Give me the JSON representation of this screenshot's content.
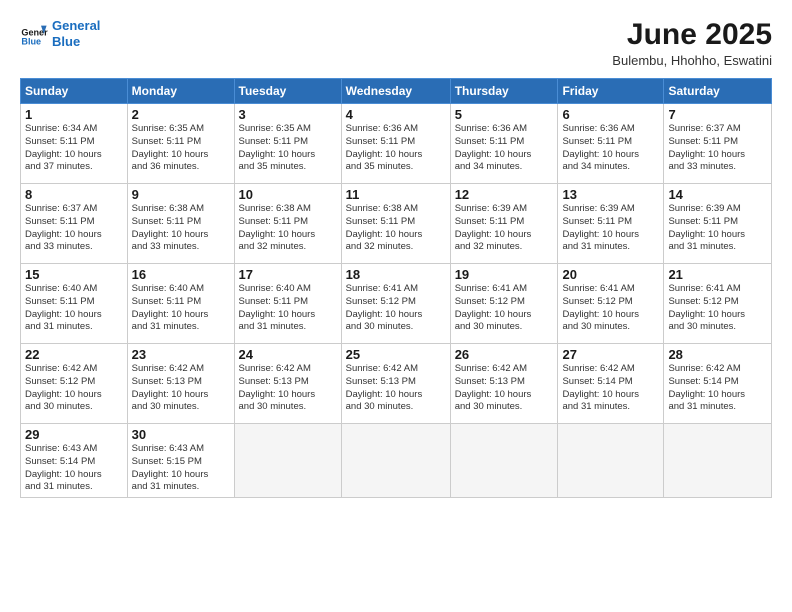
{
  "header": {
    "logo_line1": "General",
    "logo_line2": "Blue",
    "month": "June 2025",
    "location": "Bulembu, Hhohho, Eswatini"
  },
  "weekdays": [
    "Sunday",
    "Monday",
    "Tuesday",
    "Wednesday",
    "Thursday",
    "Friday",
    "Saturday"
  ],
  "weeks": [
    [
      {
        "day": "1",
        "info": "Sunrise: 6:34 AM\nSunset: 5:11 PM\nDaylight: 10 hours\nand 37 minutes."
      },
      {
        "day": "2",
        "info": "Sunrise: 6:35 AM\nSunset: 5:11 PM\nDaylight: 10 hours\nand 36 minutes."
      },
      {
        "day": "3",
        "info": "Sunrise: 6:35 AM\nSunset: 5:11 PM\nDaylight: 10 hours\nand 35 minutes."
      },
      {
        "day": "4",
        "info": "Sunrise: 6:36 AM\nSunset: 5:11 PM\nDaylight: 10 hours\nand 35 minutes."
      },
      {
        "day": "5",
        "info": "Sunrise: 6:36 AM\nSunset: 5:11 PM\nDaylight: 10 hours\nand 34 minutes."
      },
      {
        "day": "6",
        "info": "Sunrise: 6:36 AM\nSunset: 5:11 PM\nDaylight: 10 hours\nand 34 minutes."
      },
      {
        "day": "7",
        "info": "Sunrise: 6:37 AM\nSunset: 5:11 PM\nDaylight: 10 hours\nand 33 minutes."
      }
    ],
    [
      {
        "day": "8",
        "info": "Sunrise: 6:37 AM\nSunset: 5:11 PM\nDaylight: 10 hours\nand 33 minutes."
      },
      {
        "day": "9",
        "info": "Sunrise: 6:38 AM\nSunset: 5:11 PM\nDaylight: 10 hours\nand 33 minutes."
      },
      {
        "day": "10",
        "info": "Sunrise: 6:38 AM\nSunset: 5:11 PM\nDaylight: 10 hours\nand 32 minutes."
      },
      {
        "day": "11",
        "info": "Sunrise: 6:38 AM\nSunset: 5:11 PM\nDaylight: 10 hours\nand 32 minutes."
      },
      {
        "day": "12",
        "info": "Sunrise: 6:39 AM\nSunset: 5:11 PM\nDaylight: 10 hours\nand 32 minutes."
      },
      {
        "day": "13",
        "info": "Sunrise: 6:39 AM\nSunset: 5:11 PM\nDaylight: 10 hours\nand 31 minutes."
      },
      {
        "day": "14",
        "info": "Sunrise: 6:39 AM\nSunset: 5:11 PM\nDaylight: 10 hours\nand 31 minutes."
      }
    ],
    [
      {
        "day": "15",
        "info": "Sunrise: 6:40 AM\nSunset: 5:11 PM\nDaylight: 10 hours\nand 31 minutes."
      },
      {
        "day": "16",
        "info": "Sunrise: 6:40 AM\nSunset: 5:11 PM\nDaylight: 10 hours\nand 31 minutes."
      },
      {
        "day": "17",
        "info": "Sunrise: 6:40 AM\nSunset: 5:11 PM\nDaylight: 10 hours\nand 31 minutes."
      },
      {
        "day": "18",
        "info": "Sunrise: 6:41 AM\nSunset: 5:12 PM\nDaylight: 10 hours\nand 30 minutes."
      },
      {
        "day": "19",
        "info": "Sunrise: 6:41 AM\nSunset: 5:12 PM\nDaylight: 10 hours\nand 30 minutes."
      },
      {
        "day": "20",
        "info": "Sunrise: 6:41 AM\nSunset: 5:12 PM\nDaylight: 10 hours\nand 30 minutes."
      },
      {
        "day": "21",
        "info": "Sunrise: 6:41 AM\nSunset: 5:12 PM\nDaylight: 10 hours\nand 30 minutes."
      }
    ],
    [
      {
        "day": "22",
        "info": "Sunrise: 6:42 AM\nSunset: 5:12 PM\nDaylight: 10 hours\nand 30 minutes."
      },
      {
        "day": "23",
        "info": "Sunrise: 6:42 AM\nSunset: 5:13 PM\nDaylight: 10 hours\nand 30 minutes."
      },
      {
        "day": "24",
        "info": "Sunrise: 6:42 AM\nSunset: 5:13 PM\nDaylight: 10 hours\nand 30 minutes."
      },
      {
        "day": "25",
        "info": "Sunrise: 6:42 AM\nSunset: 5:13 PM\nDaylight: 10 hours\nand 30 minutes."
      },
      {
        "day": "26",
        "info": "Sunrise: 6:42 AM\nSunset: 5:13 PM\nDaylight: 10 hours\nand 30 minutes."
      },
      {
        "day": "27",
        "info": "Sunrise: 6:42 AM\nSunset: 5:14 PM\nDaylight: 10 hours\nand 31 minutes."
      },
      {
        "day": "28",
        "info": "Sunrise: 6:42 AM\nSunset: 5:14 PM\nDaylight: 10 hours\nand 31 minutes."
      }
    ],
    [
      {
        "day": "29",
        "info": "Sunrise: 6:43 AM\nSunset: 5:14 PM\nDaylight: 10 hours\nand 31 minutes."
      },
      {
        "day": "30",
        "info": "Sunrise: 6:43 AM\nSunset: 5:15 PM\nDaylight: 10 hours\nand 31 minutes."
      },
      {
        "day": "",
        "info": ""
      },
      {
        "day": "",
        "info": ""
      },
      {
        "day": "",
        "info": ""
      },
      {
        "day": "",
        "info": ""
      },
      {
        "day": "",
        "info": ""
      }
    ]
  ]
}
